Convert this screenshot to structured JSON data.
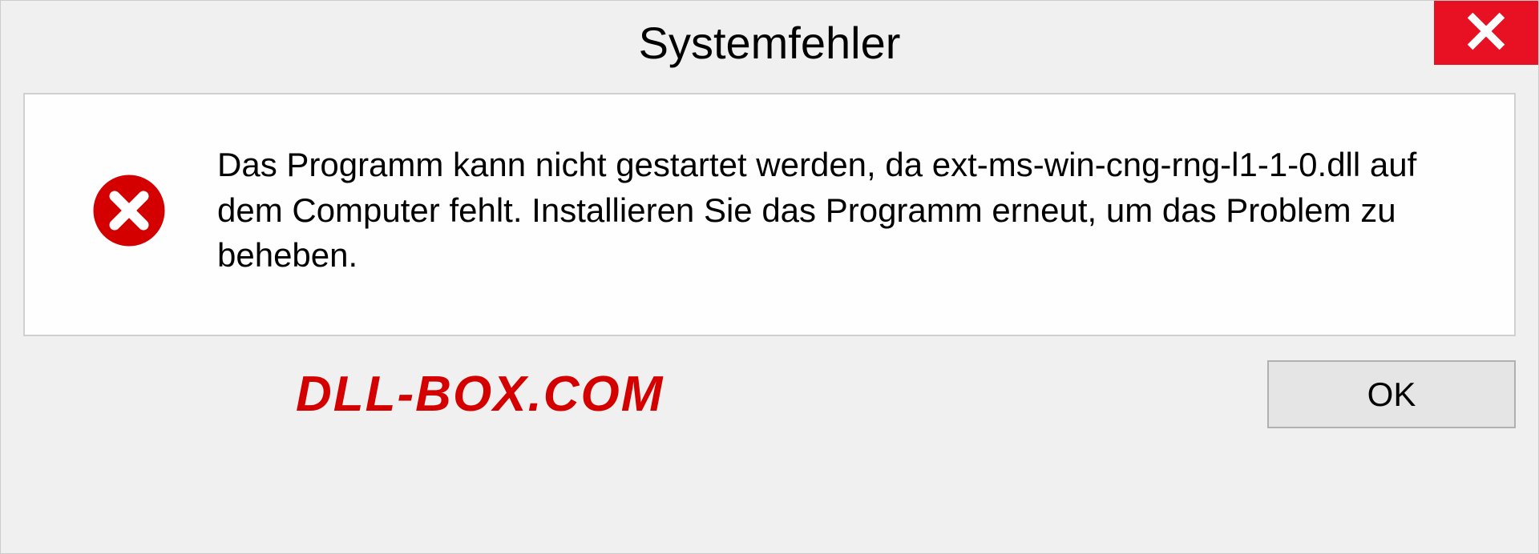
{
  "dialog": {
    "title": "Systemfehler",
    "message": "Das Programm kann nicht gestartet werden, da ext-ms-win-cng-rng-l1-1-0.dll auf dem Computer fehlt. Installieren Sie das Programm erneut, um das Problem zu beheben.",
    "ok_label": "OK"
  },
  "watermark": "DLL-BOX.COM"
}
